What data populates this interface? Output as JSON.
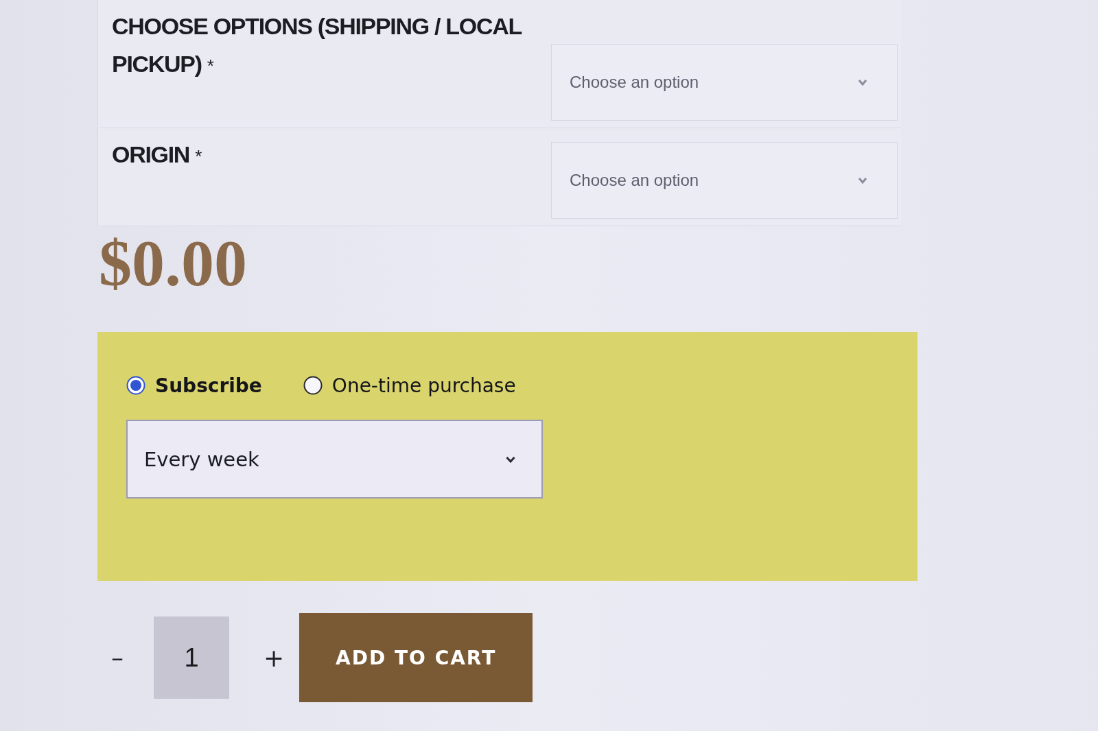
{
  "fields": [
    {
      "label": "CHOOSE OPTIONS (SHIPPING / LOCAL PICKUP)",
      "required_mark": "*",
      "placeholder": "Choose an option"
    },
    {
      "label": "ORIGIN",
      "required_mark": "*",
      "placeholder": "Choose an option"
    }
  ],
  "price": "$0.00",
  "purchase_options": {
    "options": [
      {
        "label": "Subscribe",
        "selected": true
      },
      {
        "label": "One-time purchase",
        "selected": false
      }
    ],
    "frequency": {
      "value": "Every week"
    }
  },
  "quantity": {
    "decrease": "–",
    "value": "1",
    "increase": "+"
  },
  "add_to_cart": "ADD TO CART"
}
